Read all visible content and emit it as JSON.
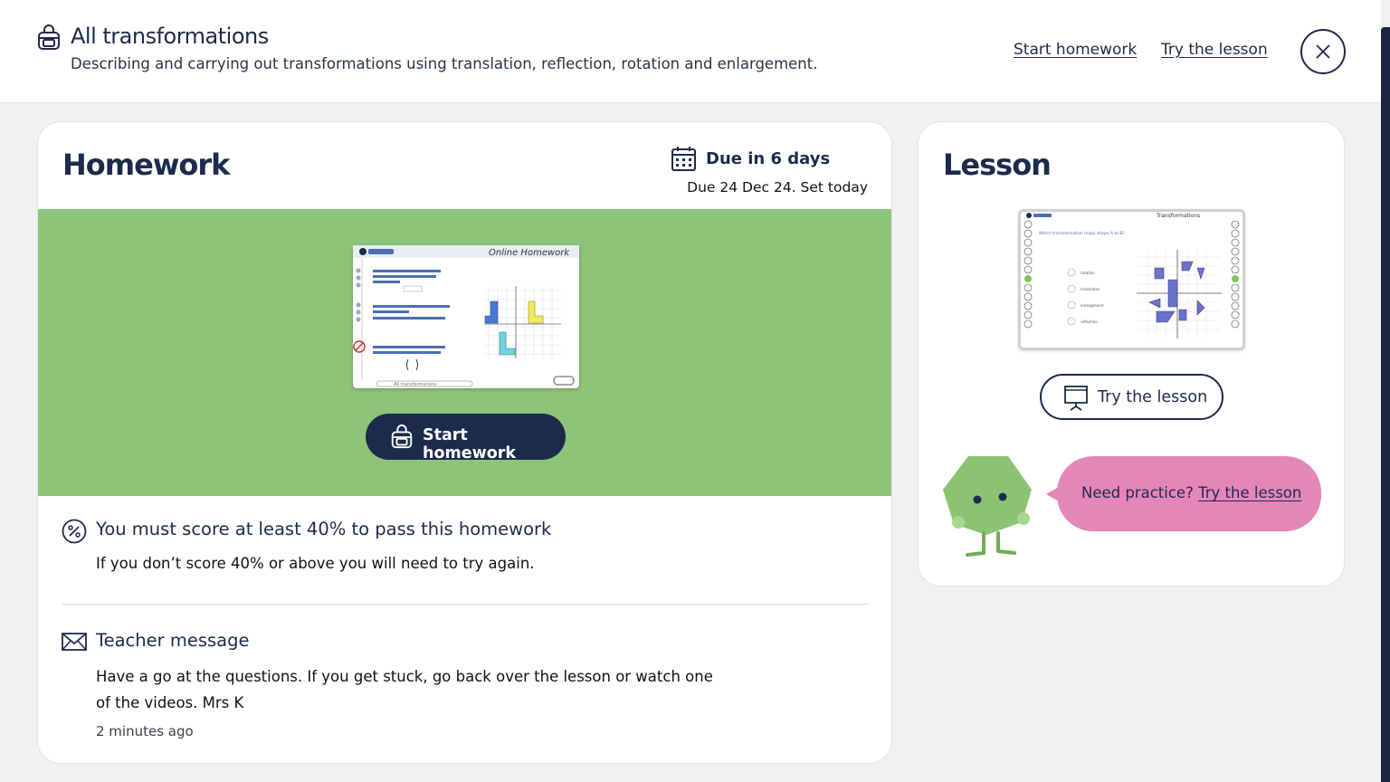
{
  "header": {
    "title": "All transformations",
    "subtitle": "Describing and carrying out transformations using translation, reflection, rotation and enlargement.",
    "start_homework_link": "Start homework",
    "try_lesson_link": "Try the lesson"
  },
  "homework": {
    "title": "Homework",
    "due_main": "Due in 6 days",
    "due_sub": "Due 24 Dec 24. Set today",
    "preview_heading": "Online Homework",
    "preview_footer": "All transformations",
    "start_button": "Start homework",
    "pass_title": "You must score at least 40% to pass this homework",
    "pass_body": "If you don’t score 40% or above you will need to try again.",
    "message_title": "Teacher message",
    "message_body": "Have a go at the questions. If you get stuck, go back over the lesson or watch one of the videos. Mrs K",
    "message_time": "2 minutes ago"
  },
  "lesson": {
    "title": "Lesson",
    "preview_heading": "Transformations",
    "preview_question": "Which transformation maps shape A to B?",
    "preview_options": [
      "rotation",
      "translation",
      "enlargement",
      "reflection"
    ],
    "try_button": "Try the lesson",
    "bubble_text": "Need practice?",
    "bubble_link": "Try the lesson"
  },
  "colors": {
    "navy": "#1c2b4b",
    "green_band": "#8ec479",
    "bubble_pink": "#e486b7",
    "mascot_green": "#8cc373"
  },
  "icons": [
    "backpack-icon",
    "close-icon",
    "calendar-icon",
    "percent-icon",
    "mail-icon",
    "presentation-icon"
  ]
}
